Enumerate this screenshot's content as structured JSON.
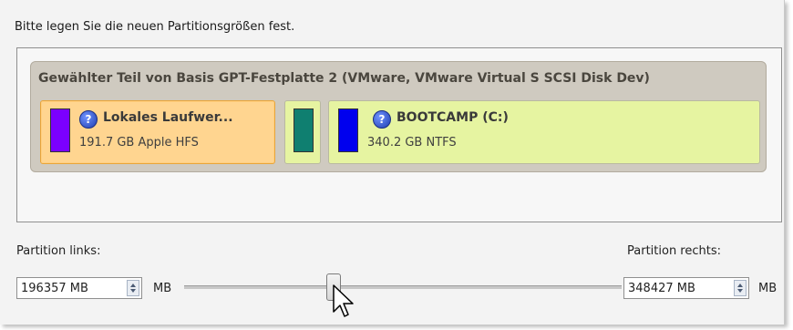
{
  "instruction": "Bitte legen Sie die neuen Partitionsgrößen fest.",
  "disk": {
    "title": "Gewählter Teil von Basis GPT-Festplatte 2 (VMware, VMware Virtual S SCSI Disk Dev)",
    "partitions": [
      {
        "name": "Lokales Laufwer...",
        "size": "191.7 GB Apple HFS",
        "color": "#7b00ff",
        "selected": true,
        "has_help_icon": true
      },
      {
        "name": "",
        "size": "",
        "color": "#0f7f70",
        "selected": false,
        "has_help_icon": false
      },
      {
        "name": "BOOTCAMP (C:)",
        "size": "340.2 GB NTFS",
        "color": "#0000ee",
        "selected": false,
        "has_help_icon": true
      }
    ]
  },
  "controls": {
    "left_label": "Partition links:",
    "left_value": "196357 MB",
    "left_unit": "MB",
    "right_label": "Partition rechts:",
    "right_value": "348427 MB",
    "right_unit": "MB"
  },
  "icons": {
    "help": "question-circle-icon",
    "spin": "spinner-arrows-icon",
    "cursor": "mouse-pointer-icon"
  }
}
